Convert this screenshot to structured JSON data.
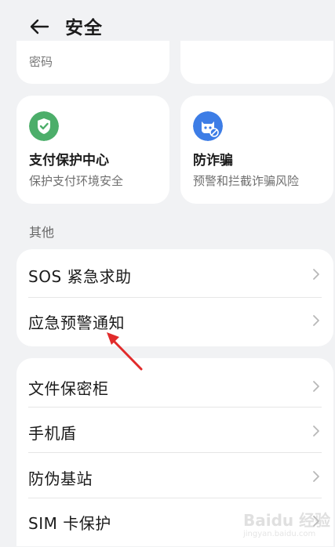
{
  "header": {
    "title": "安全",
    "back_icon": "arrow-left-icon"
  },
  "top_cards": {
    "left_sub": "密码"
  },
  "features": [
    {
      "title": "支付保护中心",
      "subtitle": "保护支付环境安全",
      "icon": "shield-check-icon",
      "color": "#4cae6a"
    },
    {
      "title": "防诈骗",
      "subtitle": "预警和拦截诈骗风险",
      "icon": "fraud-guard-icon",
      "color": "#3d7de6"
    }
  ],
  "section": {
    "label": "其他"
  },
  "group_a": [
    {
      "label": "SOS 紧急求助"
    },
    {
      "label": "应急预警通知"
    }
  ],
  "group_b": [
    {
      "label": "文件保密柜"
    },
    {
      "label": "手机盾"
    },
    {
      "label": "防伪基站"
    },
    {
      "label": "SIM 卡保护"
    }
  ],
  "watermark": {
    "main": "Baidu 经验",
    "sub": "jingyan.baidu.com"
  }
}
